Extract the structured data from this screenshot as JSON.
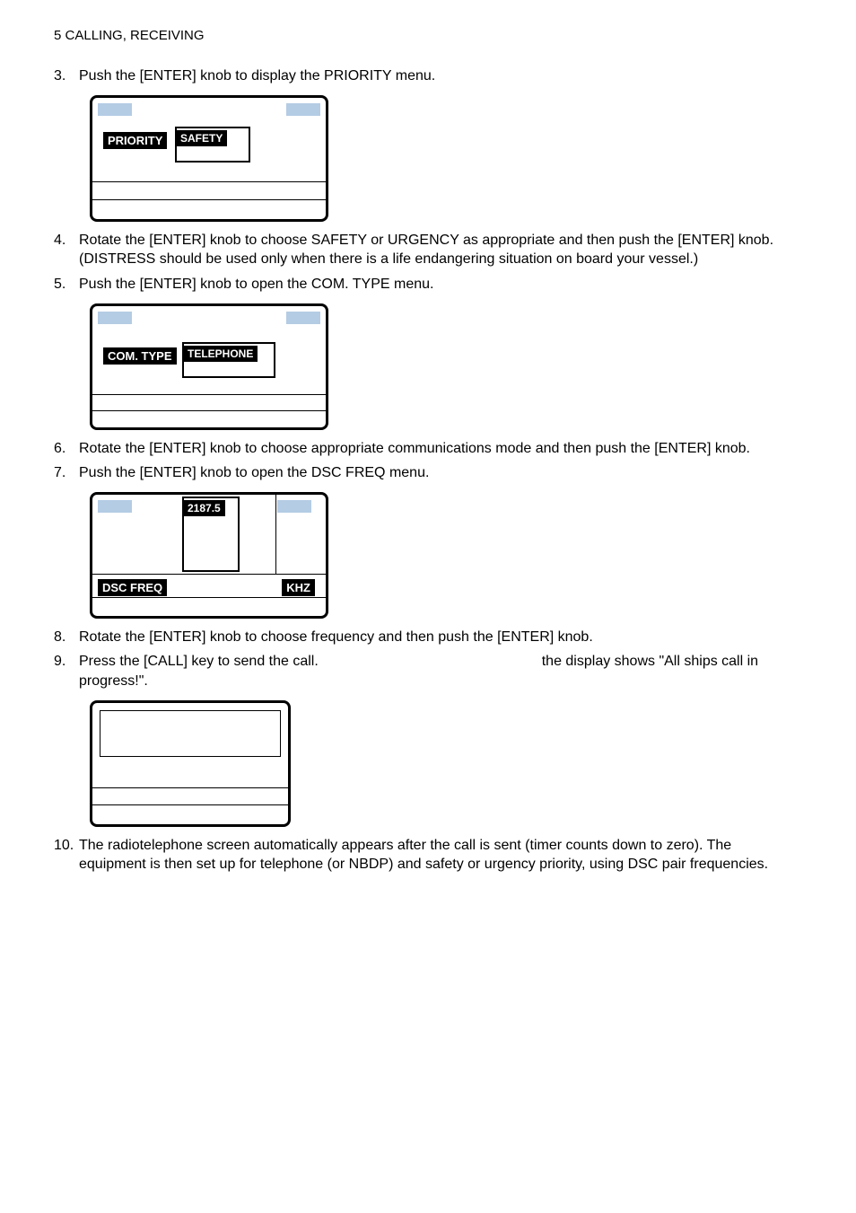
{
  "header": "5   CALLING, RECEIVING",
  "items": {
    "3": "Push the [ENTER] knob to display the PRIORITY menu.",
    "4": "Rotate the [ENTER] knob to choose SAFETY or URGENCY as appropriate and then push the [ENTER] knob.(DISTRESS should be used only when there is a life endangering situation on board your vessel.)",
    "5": "Push the [ENTER] knob to open the COM. TYPE menu.",
    "6": "Rotate the [ENTER] knob to choose appropriate communications mode and then push the [ENTER] knob.",
    "7": "Push the [ENTER] knob to open the DSC FREQ menu.",
    "8": "Rotate the [ENTER] knob to choose frequency and then push the [ENTER] knob.",
    "9a": "Press the [CALL] key to send the call.",
    "9b": "the display shows \"All ships call in progress!\".",
    "10": "The radiotelephone screen automatically appears after the call is sent (timer counts down to zero). The equipment is then set up for telephone (or NBDP) and safety or urgency priority, using DSC pair frequencies."
  },
  "screens": {
    "s1": {
      "label": "PRIORITY",
      "value": "SAFETY"
    },
    "s2": {
      "label": "COM. TYPE",
      "value": "TELEPHONE"
    },
    "s3": {
      "label": "DSC FREQ",
      "value": "2187.5",
      "unit": "KHZ"
    }
  }
}
